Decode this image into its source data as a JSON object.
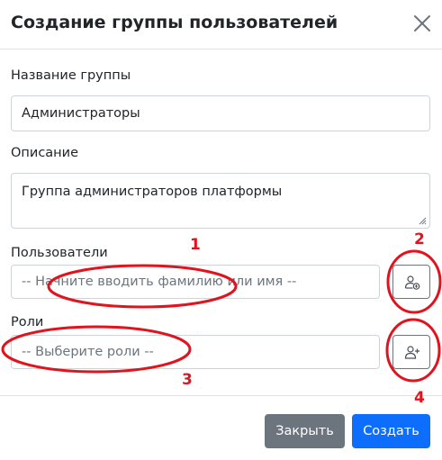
{
  "modal": {
    "title": "Создание группы пользователей"
  },
  "form": {
    "group_name": {
      "label": "Название группы",
      "value": "Администраторы"
    },
    "description": {
      "label": "Описание",
      "value": "Группа администраторов платформы"
    },
    "users": {
      "label": "Пользователи",
      "placeholder": "-- Начните вводить фамилию или имя --"
    },
    "roles": {
      "label": "Роли",
      "placeholder": "-- Выберите роли --"
    }
  },
  "footer": {
    "close_label": "Закрыть",
    "create_label": "Создать"
  },
  "annotations": {
    "n1": "1",
    "n2": "2",
    "n3": "3",
    "n4": "4"
  },
  "colors": {
    "primary": "#0d6efd",
    "secondary": "#6c757d",
    "annotation": "#e0141e"
  }
}
